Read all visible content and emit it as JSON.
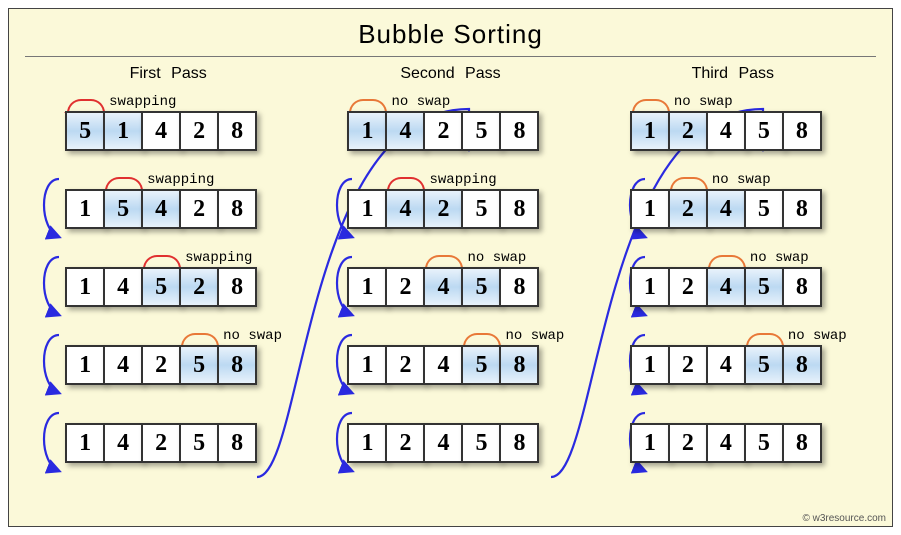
{
  "title": "Bubble  Sorting",
  "credit": "© w3resource.com",
  "label_swap": "swapping",
  "label_noswap": "no swap",
  "colors": {
    "highlight": "#bcd9f2",
    "swap_arc": "#e03030",
    "noswap_arc": "#e87838",
    "connector": "#2a2ae0"
  },
  "columns": [
    {
      "title": "First  Pass",
      "steps": [
        {
          "cells": [
            "5",
            "1",
            "4",
            "2",
            "8"
          ],
          "hl": [
            0,
            1
          ],
          "arc": {
            "type": "swap",
            "pos": 0
          }
        },
        {
          "cells": [
            "1",
            "5",
            "4",
            "2",
            "8"
          ],
          "hl": [
            1,
            2
          ],
          "arc": {
            "type": "swap",
            "pos": 1
          }
        },
        {
          "cells": [
            "1",
            "4",
            "5",
            "2",
            "8"
          ],
          "hl": [
            2,
            3
          ],
          "arc": {
            "type": "swap",
            "pos": 2
          }
        },
        {
          "cells": [
            "1",
            "4",
            "2",
            "5",
            "8"
          ],
          "hl": [
            3,
            4
          ],
          "arc": {
            "type": "noswap",
            "pos": 3
          }
        },
        {
          "cells": [
            "1",
            "4",
            "2",
            "5",
            "8"
          ],
          "hl": [],
          "arc": null
        }
      ]
    },
    {
      "title": "Second  Pass",
      "steps": [
        {
          "cells": [
            "1",
            "4",
            "2",
            "5",
            "8"
          ],
          "hl": [
            0,
            1
          ],
          "arc": {
            "type": "noswap",
            "pos": 0
          }
        },
        {
          "cells": [
            "1",
            "4",
            "2",
            "5",
            "8"
          ],
          "hl": [
            1,
            2
          ],
          "arc": {
            "type": "swap",
            "pos": 1
          }
        },
        {
          "cells": [
            "1",
            "2",
            "4",
            "5",
            "8"
          ],
          "hl": [
            2,
            3
          ],
          "arc": {
            "type": "noswap",
            "pos": 2
          }
        },
        {
          "cells": [
            "1",
            "2",
            "4",
            "5",
            "8"
          ],
          "hl": [
            3,
            4
          ],
          "arc": {
            "type": "noswap",
            "pos": 3
          }
        },
        {
          "cells": [
            "1",
            "2",
            "4",
            "5",
            "8"
          ],
          "hl": [],
          "arc": null
        }
      ]
    },
    {
      "title": "Third  Pass",
      "steps": [
        {
          "cells": [
            "1",
            "2",
            "4",
            "5",
            "8"
          ],
          "hl": [
            0,
            1
          ],
          "arc": {
            "type": "noswap",
            "pos": 0
          }
        },
        {
          "cells": [
            "1",
            "2",
            "4",
            "5",
            "8"
          ],
          "hl": [
            1,
            2
          ],
          "arc": {
            "type": "noswap",
            "pos": 1
          }
        },
        {
          "cells": [
            "1",
            "2",
            "4",
            "5",
            "8"
          ],
          "hl": [
            2,
            3
          ],
          "arc": {
            "type": "noswap",
            "pos": 2
          }
        },
        {
          "cells": [
            "1",
            "2",
            "4",
            "5",
            "8"
          ],
          "hl": [
            3,
            4
          ],
          "arc": {
            "type": "noswap",
            "pos": 3
          }
        },
        {
          "cells": [
            "1",
            "2",
            "4",
            "5",
            "8"
          ],
          "hl": [],
          "arc": null
        }
      ]
    }
  ]
}
